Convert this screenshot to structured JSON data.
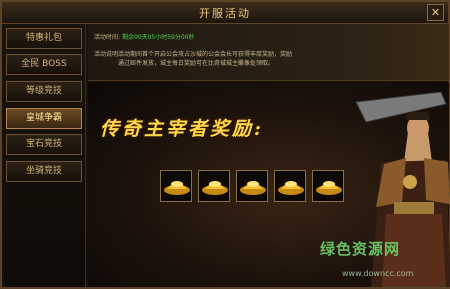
{
  "window": {
    "title": "开服活动",
    "close_label": "✕"
  },
  "sidebar": {
    "items": [
      {
        "label": "特惠礼包",
        "active": false
      },
      {
        "label": "全民 BOSS",
        "active": false
      },
      {
        "label": "等级竞技",
        "active": false
      },
      {
        "label": "皇城争霸",
        "active": true
      },
      {
        "label": "宝石竞技",
        "active": false
      },
      {
        "label": "坐骑竞技",
        "active": false
      }
    ]
  },
  "activity": {
    "time_label": "活动时间:",
    "time_value": "剩余00天05小时59分00秒",
    "desc_label": "活动说明:",
    "desc_line1": "活动期间首个开启公会攻占沙城的公会会长可获得丰厚奖励，奖励",
    "desc_line2": "通过邮件发放，城主每日奖励可在比奇城城主雕像处领取。"
  },
  "banner": {
    "title": "传奇主宰者奖励:",
    "rewards": [
      "gold-ingot",
      "gold-ingot",
      "gold-ingot",
      "gold-ingot",
      "gold-ingot"
    ]
  },
  "watermark": {
    "text": "绿色资源网",
    "url": "www.downcc.com"
  },
  "colors": {
    "accent": "#ffd84a",
    "time_green": "#4fd14f",
    "border": "#8a7140"
  }
}
